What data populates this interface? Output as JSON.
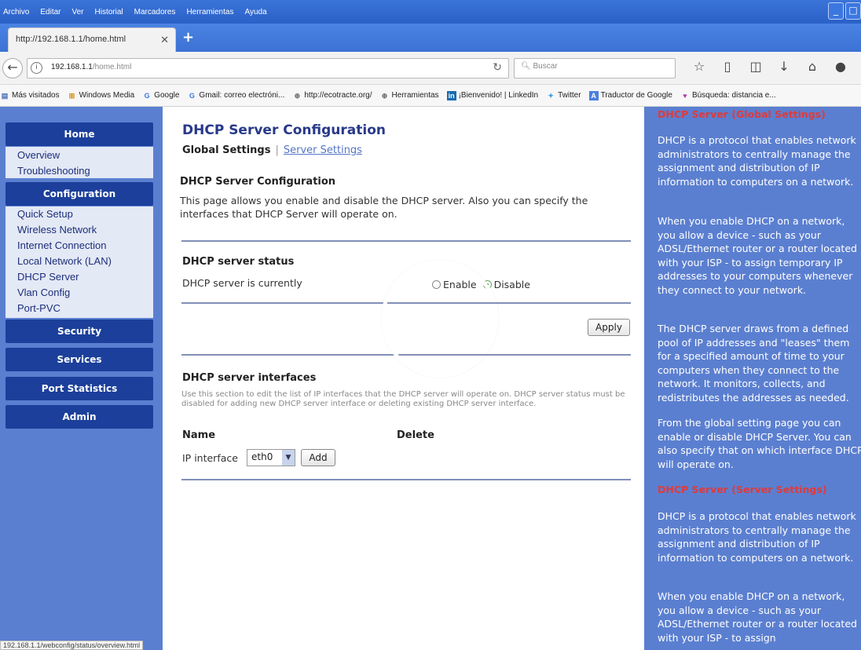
{
  "menu": [
    "Archivo",
    "Editar",
    "Ver",
    "Historial",
    "Marcadores",
    "Herramientas",
    "Ayuda"
  ],
  "tab": {
    "title": "http://192.168.1.1/home.html"
  },
  "nav": {
    "url_host": "192.168.1.1",
    "url_path": "/home.html",
    "search_placeholder": "Buscar"
  },
  "bookmarks": [
    "Más visitados",
    "Windows Media",
    "Google",
    "Gmail: correo electróni...",
    "http://ecotracte.org/",
    "Herramientas",
    "¡Bienvenido! | LinkedIn",
    "Twitter",
    "Traductor de Google",
    "Búsqueda: distancia e..."
  ],
  "sidebar": {
    "home": "Home",
    "home_items": [
      "Overview",
      "Troubleshooting"
    ],
    "configuration": "Configuration",
    "config_items": [
      "Quick Setup",
      "Wireless Network",
      "Internet Connection",
      "Local Network (LAN)",
      "DHCP Server",
      "Vlan Config",
      "Port-PVC"
    ],
    "security": "Security",
    "services": "Services",
    "port_statistics": "Port Statistics",
    "admin": "Admin"
  },
  "main": {
    "title": "DHCP Server Configuration",
    "tab_active": "Global Settings",
    "tab_sep": "|",
    "tab_link": "Server Settings",
    "section1_title": "DHCP Server Configuration",
    "section1_desc": "This page allows you enable and disable the DHCP server. Also you can specify the interfaces that DHCP Server will operate on.",
    "status_title": "DHCP server status",
    "status_label": "DHCP server is currently",
    "enable_label": "Enable",
    "disable_label": "Disable",
    "selected": "Disable",
    "apply_label": "Apply",
    "interfaces_title": "DHCP server interfaces",
    "interfaces_desc": "Use this section to edit the list of IP interfaces that the DHCP server will operate on. DHCP server status must be disabled for adding new DHCP server interface or deleting existing DHCP server interface.",
    "col_name": "Name",
    "col_delete": "Delete",
    "ip_interface_label": "IP interface",
    "select_value": "eth0",
    "add_label": "Add"
  },
  "help": {
    "head1": "DHCP Server (Global Settings)",
    "p1": "DHCP is a protocol that enables network administrators to centrally manage the assignment and distribution of IP information to computers on a network.",
    "p2": "When you enable DHCP on a network, you allow a device - such as your ADSL/Ethernet router or a router located with your ISP - to assign temporary IP addresses to your computers whenever they connect to your network.",
    "p3": "The DHCP server draws from a defined pool of IP addresses and \"leases\" them for a specified amount of time to your computers when they connect to the network. It monitors, collects, and redistributes the addresses as needed.",
    "p4": "From the global setting page you can enable or disable DHCP Server. You can also specify that on which interface DHCP will operate on.",
    "head2": "DHCP Server (Server Settings)",
    "p5": "DHCP is a protocol that enables network administrators to centrally manage the assignment and distribution of IP information to computers on a network.",
    "p6": "When you enable DHCP on a network, you allow a device - such as your ADSL/Ethernet router or a router located with your ISP - to assign"
  },
  "status_bar": "192.168.1.1/webconfig/status/overview.html",
  "colors": {
    "sidebar_bg": "#5b7fd0",
    "header_bg": "#1b3f9a",
    "title": "#28398a",
    "help_head": "#e03a3a"
  }
}
